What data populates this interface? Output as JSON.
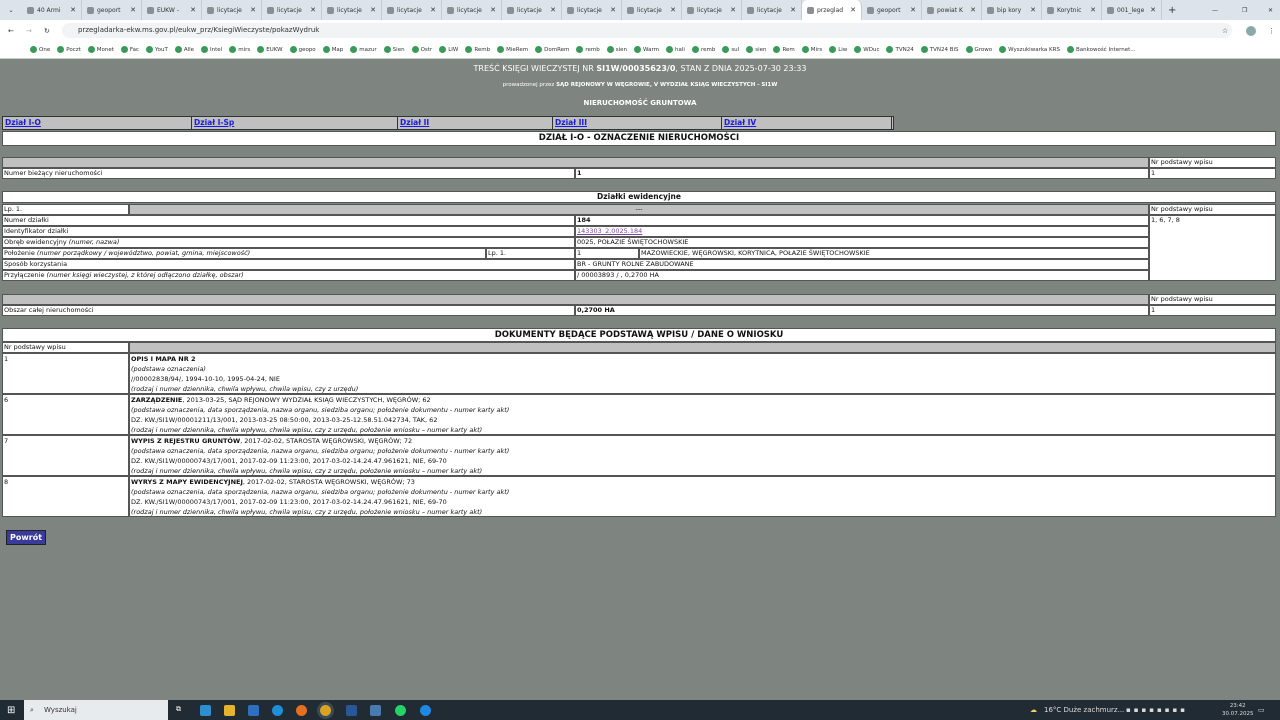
{
  "browser": {
    "tabs": [
      {
        "label": "40 Armi"
      },
      {
        "label": "geoport"
      },
      {
        "label": "EUKW - "
      },
      {
        "label": "licytacje"
      },
      {
        "label": "licytacje"
      },
      {
        "label": "licytacje"
      },
      {
        "label": "licytacje"
      },
      {
        "label": "licytacje"
      },
      {
        "label": "licytacje"
      },
      {
        "label": "licytacje"
      },
      {
        "label": "licytacje"
      },
      {
        "label": "licytacje"
      },
      {
        "label": "licytacje"
      },
      {
        "label": "przeglad",
        "active": true
      },
      {
        "label": "geoport"
      },
      {
        "label": "powiat K"
      },
      {
        "label": "bip kory"
      },
      {
        "label": "Korytnic"
      },
      {
        "label": "001_lege"
      }
    ],
    "url": "przegladarka-ekw.ms.gov.pl/eukw_prz/KsiegiWieczyste/pokazWydruk",
    "bookmarks": [
      "One",
      "Poczt",
      "Monet",
      "Fac",
      "YouT",
      "Alle",
      "Intel",
      "mirs",
      "EUKW",
      "geopo",
      "Map",
      "mazur",
      "Sien",
      "Ostr",
      "LIW",
      "Remb",
      "MieRem",
      "DomRem",
      "remb",
      "sien",
      "Warm",
      "hali",
      "remb",
      "sul",
      "sien",
      "Rem",
      "Mirs",
      "Liw",
      "WDuc",
      "TVN24",
      "TVN24 BiS",
      "Growo",
      "Wyszukiwarka KRS",
      "Bankowość Internet..."
    ]
  },
  "header": {
    "title_prefix": "TREŚĆ KSIĘGI WIECZYSTEJ NR ",
    "kw": "SI1W/00035623/0",
    "title_suffix": ", STAN Z DNIA 2025-07-30 23:33",
    "court_prefix": "prowadzonej przez ",
    "court": "SĄD REJONOWY W WĘGROWIE, V WYDZIAŁ KSIĄG WIECZYSTYCH - SI1W",
    "type": "NIERUCHOMOŚĆ GRUNTOWA"
  },
  "nav": [
    "Dział I-O",
    "Dział I-Sp",
    "Dział II",
    "Dział III",
    "Dział IV"
  ],
  "section_title": "DZIAŁ I-O - OZNACZENIE NIERUCHOMOŚCI",
  "nr_podstawy": "Nr podstawy wpisu",
  "numer_biezacy": {
    "label": "Numer bieżący nieruchomości",
    "value": "1",
    "nr": "1"
  },
  "dzialki": {
    "title": "Działki ewidencyjne",
    "lp": "Lp. 1.",
    "dash": "---",
    "nr": "1, 6, 7, 8",
    "numer": {
      "label": "Numer działki",
      "value": "184"
    },
    "identyfikator": {
      "label": "Identyfikator działki",
      "value": "143303_2.0025.184"
    },
    "obreb": {
      "label": "Obręb ewidencyjny ",
      "hint": "(numer, nazwa)",
      "value": "0025, POŁAZIE ŚWIĘTOCHOWSKIE"
    },
    "polozenie": {
      "label": "Położenie ",
      "hint": "(numer porządkowy / województwo, powiat, gmina, miejscowość)",
      "lp": "Lp. 1.",
      "num": "1",
      "value": "MAZOWIECKIE, WĘGROWSKI, KORYTNICA, POŁAZIE ŚWIĘTOCHOWSKIE"
    },
    "sposob": {
      "label": "Sposób korzystania",
      "value": "BR - GRUNTY ROLNE ZABUDOWANE"
    },
    "przylaczenie": {
      "label": "Przyłączenie ",
      "hint": "(numer księgi wieczystej, z której odłączono działkę, obszar)",
      "value": "/ 00003893 / , 0,2700 HA"
    }
  },
  "obszar": {
    "label": "Obszar całej nieruchomości",
    "value": "0,2700 HA",
    "nr": "1"
  },
  "documents": {
    "title": "DOKUMENTY BĘDĄCE PODSTAWĄ WPISU / DANE O WNIOSKU",
    "header": "Nr podstawy wpisu",
    "rows": [
      {
        "nr": "1",
        "name": "OPIS I MAPA NR 2",
        "rest": "",
        "hint1": "(podstawa oznaczenia)",
        "line": "//00002838/94/, 1994-10-10, 1995-04-24, NIE",
        "hint2": "(rodzaj i numer dziennika, chwila wpływu, chwila wpisu, czy z urzędu)"
      },
      {
        "nr": "6",
        "name": "ZARZĄDZENIE",
        "rest": ", 2013-03-25, SĄD REJONOWY WYDZIAŁ KSIĄG WIECZYSTYCH, WĘGRÓW; 62",
        "hint1": "(podstawa oznaczenia, data sporządzenia, nazwa organu, siedziba organu; położenie dokumentu - numer karty akt)",
        "line": "DZ. KW./SI1W/00001211/13/001, 2013-03-25 08:50:00, 2013-03-25-12.58.51.042734, TAK, 62",
        "hint2": "(rodzaj i numer dziennika, chwila wpływu, chwila wpisu, czy z urzędu, położenie wniosku – numer karty akt)"
      },
      {
        "nr": "7",
        "name": "WYPIS Z REJESTRU GRUNTÓW",
        "rest": ", 2017-02-02, STAROSTA WĘGROWSKI, WĘGRÓW; 72",
        "hint1": "(podstawa oznaczenia, data sporządzenia, nazwa organu, siedziba organu; położenie dokumentu - numer karty akt)",
        "line": "DZ. KW./SI1W/00000743/17/001, 2017-02-09 11:23:00, 2017-03-02-14.24.47.961621, NIE, 69-70",
        "hint2": "(rodzaj i numer dziennika, chwila wpływu, chwila wpisu, czy z urzędu, położenie wniosku – numer karty akt)"
      },
      {
        "nr": "8",
        "name": "WYRYS Z MAPY EWIDENCYJNEJ",
        "rest": ", 2017-02-02, STAROSTA WĘGROWSKI, WĘGRÓW; 73",
        "hint1": "(podstawa oznaczenia, data sporządzenia, nazwa organu, siedziba organu; położenie dokumentu - numer karty akt)",
        "line": "DZ. KW./SI1W/00000743/17/001, 2017-02-09 11:23:00, 2017-03-02-14.24.47.961621, NIE, 69-70",
        "hint2": "(rodzaj i numer dziennika, chwila wpływu, chwila wpisu, czy z urzędu, położenie wniosku – numer karty akt)"
      }
    ]
  },
  "back_label": "Powrót",
  "taskbar": {
    "search": "Wyszukaj",
    "weather": "16°C  Duże zachmurz...",
    "time": "23:42",
    "date": "30.07.2025"
  }
}
